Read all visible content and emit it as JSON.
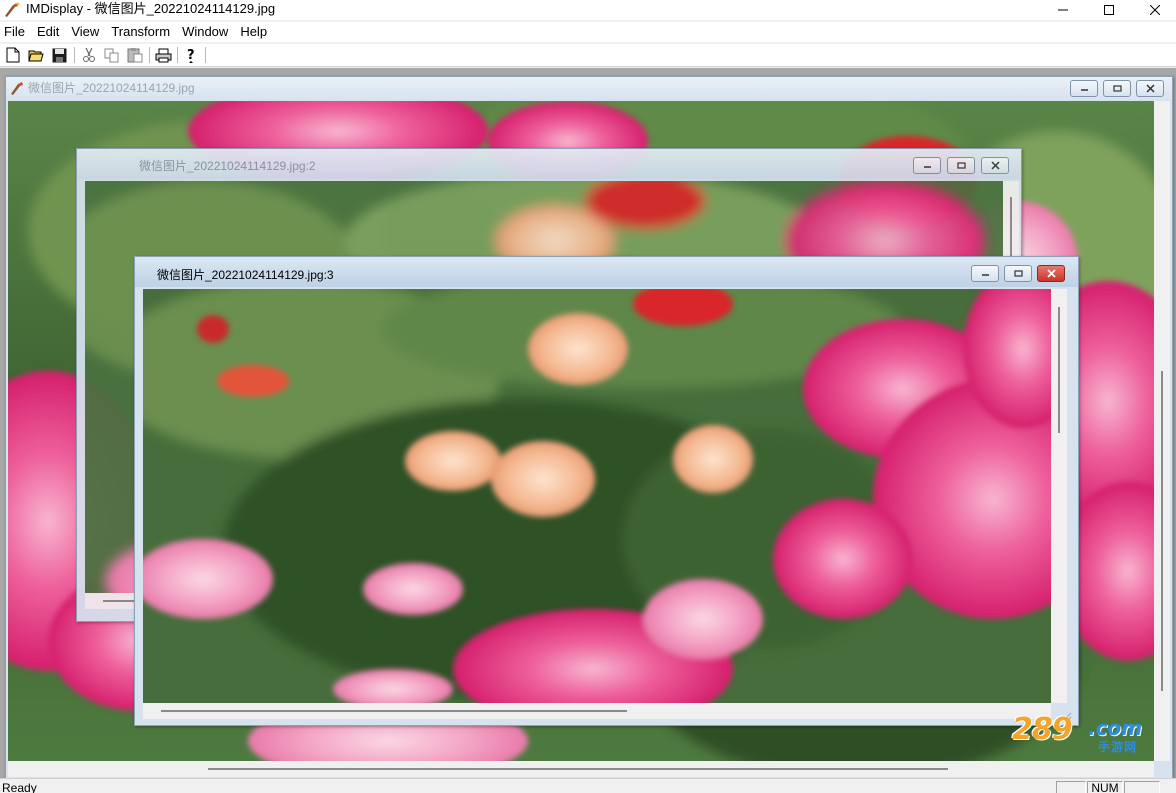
{
  "window": {
    "title": "IMDisplay - 微信图片_20221024114129.jpg"
  },
  "menu": [
    {
      "label": "File"
    },
    {
      "label": "Edit"
    },
    {
      "label": "View"
    },
    {
      "label": "Transform"
    },
    {
      "label": "Window"
    },
    {
      "label": "Help"
    }
  ],
  "toolbar": {
    "buttons": [
      "new-icon",
      "open-icon",
      "save-icon",
      "cut-icon",
      "copy-icon",
      "paste-icon",
      "print-icon",
      "help-icon"
    ]
  },
  "documents": [
    {
      "title": "微信图片_20221024114129.jpg"
    },
    {
      "title": "微信图片_20221024114129.jpg:2"
    },
    {
      "title": "微信图片_20221024114129.jpg:3"
    }
  ],
  "status": {
    "text": "Ready",
    "num": "NUM"
  },
  "watermark": {
    "number": "289",
    "domain": ".com",
    "sub": "手游网"
  },
  "colors": {
    "rose_pink": "#e8357a",
    "foliage_green": "#3f6b33",
    "coral": "#f0a07a",
    "red": "#d8282a",
    "title_active": "#c7d6e6"
  }
}
